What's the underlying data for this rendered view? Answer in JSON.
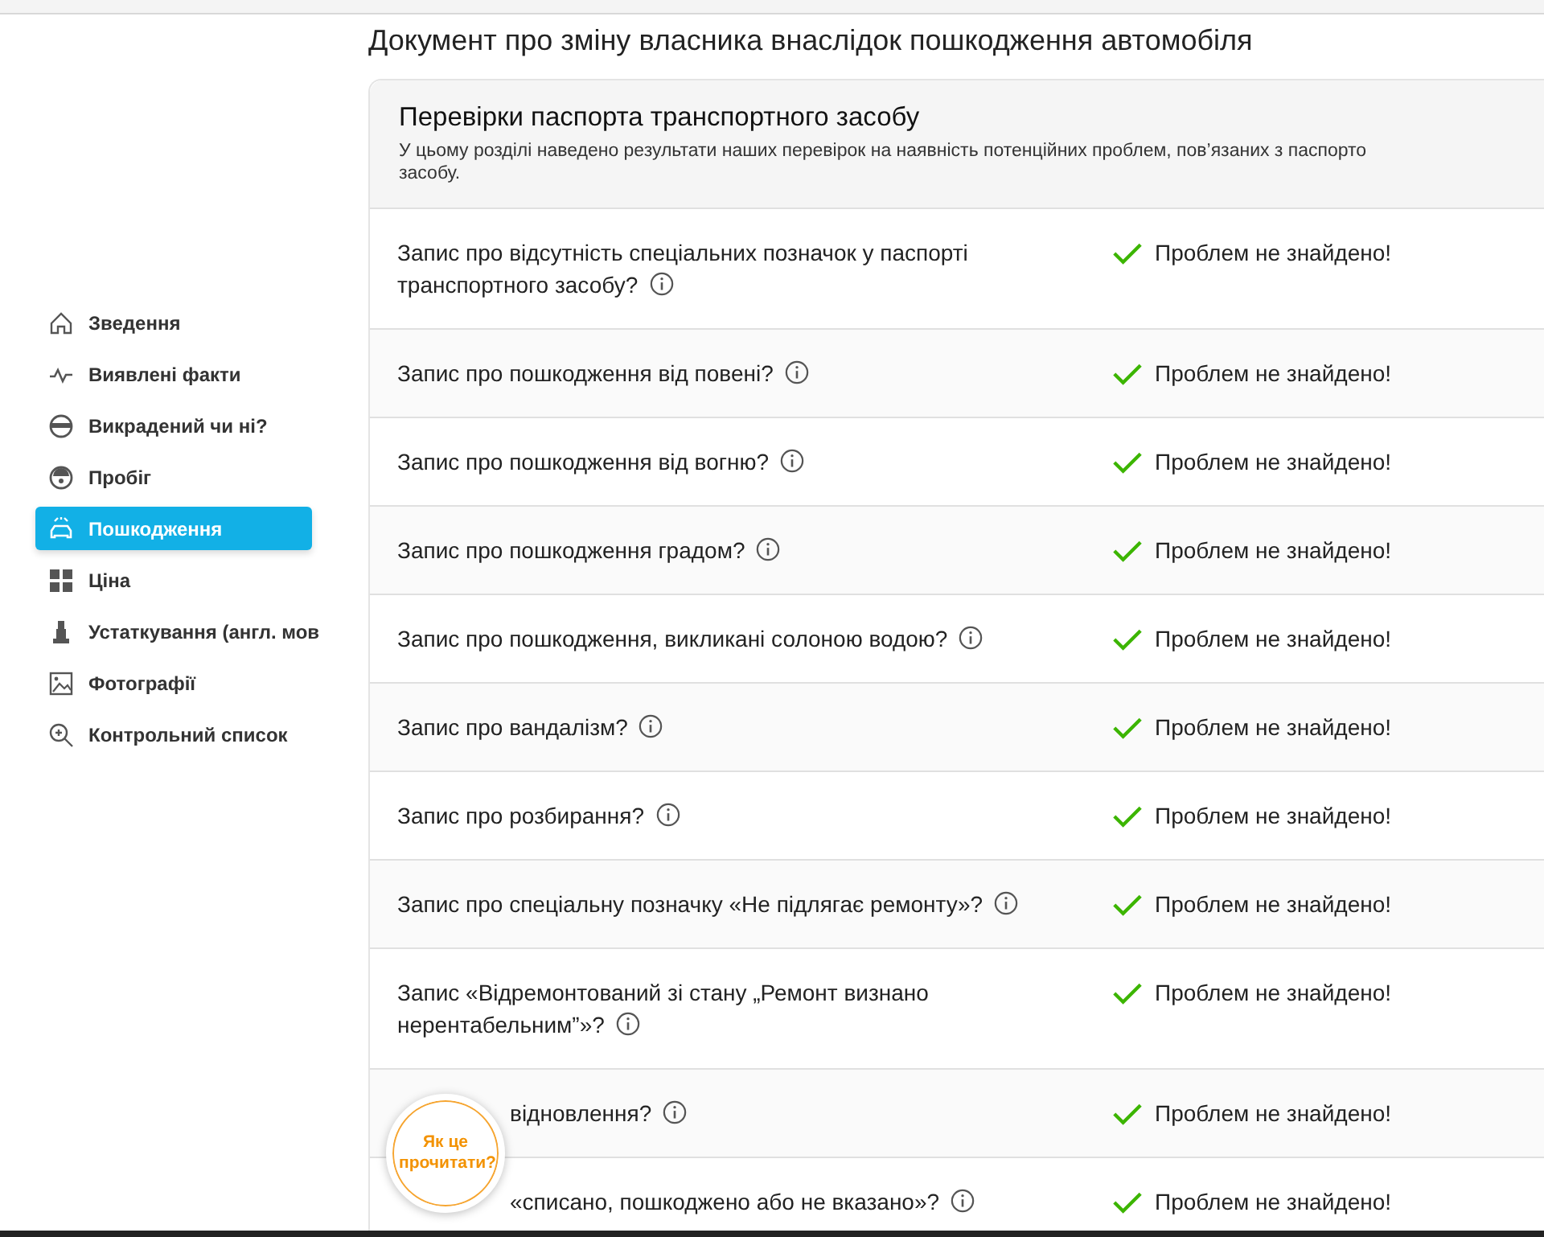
{
  "page_title": "Документ про зміну власника внаслідок пошкодження автомобіля",
  "sidebar": {
    "items": [
      {
        "label": "Зведення",
        "selected": false
      },
      {
        "label": "Виявлені факти",
        "selected": false
      },
      {
        "label": "Викрадений чи ні?",
        "selected": false
      },
      {
        "label": "Пробіг",
        "selected": false
      },
      {
        "label": "Пошкодження",
        "selected": true
      },
      {
        "label": "Ціна",
        "selected": false
      },
      {
        "label": "Устаткування (англ. мов",
        "selected": false
      },
      {
        "label": "Фотографії",
        "selected": false
      },
      {
        "label": "Контрольний список",
        "selected": false
      }
    ]
  },
  "section": {
    "title": "Перевірки паспорта транспортного засобу",
    "description_lines": [
      "У цьому розділі наведено результати наших перевірок на наявність потенційних проблем, пов’язаних з паспорто",
      "засобу."
    ],
    "rows": [
      {
        "kind": "full",
        "question": "Запис про відсутність спеціальних позначок у паспорті транспортного засобу?",
        "result": "Проблем не знайдено!",
        "ok": true
      },
      {
        "kind": "full",
        "question": "Запис про пошкодження від повені?",
        "result": "Проблем не знайдено!",
        "ok": true
      },
      {
        "kind": "full",
        "question": "Запис про пошкодження від вогню?",
        "result": "Проблем не знайдено!",
        "ok": true
      },
      {
        "kind": "full",
        "question": "Запис про пошкодження градом?",
        "result": "Проблем не знайдено!",
        "ok": true
      },
      {
        "kind": "full",
        "question": "Запис про пошкодження, викликані солоною водою?",
        "result": "Проблем не знайдено!",
        "ok": true
      },
      {
        "kind": "full",
        "question": "Запис про вандалізм?",
        "result": "Проблем не знайдено!",
        "ok": true
      },
      {
        "kind": "full",
        "question": "Запис про розбирання?",
        "result": "Проблем не знайдено!",
        "ok": true
      },
      {
        "kind": "full",
        "question": "Запис про спеціальну позначку «Не підлягає ремонту»?",
        "result": "Проблем не знайдено!",
        "ok": true
      },
      {
        "kind": "full",
        "question": "Запис «Відремонтований зі стану „Ремонт визнано нерентабельним”»?",
        "result": "Проблем не знайдено!",
        "ok": true
      },
      {
        "kind": "partial",
        "question": "відновлення?",
        "result": "Проблем не знайдено!",
        "ok": true
      },
      {
        "kind": "partial",
        "question": "«списано, пошкоджено або не вказано»?",
        "result": "Проблем не знайдено!",
        "ok": true
      }
    ]
  },
  "help_badge": {
    "label": "Як це прочитати?"
  }
}
